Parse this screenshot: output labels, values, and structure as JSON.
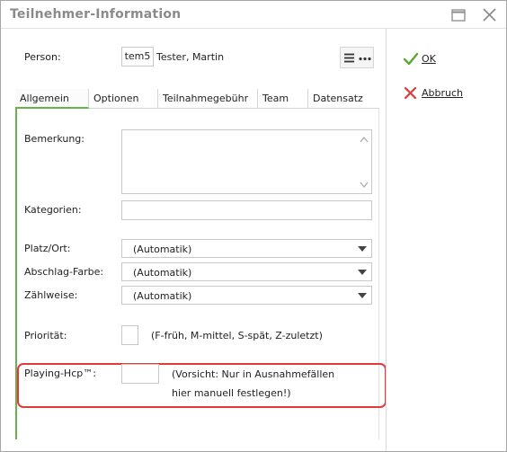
{
  "window": {
    "title": "Teilnehmer-Information"
  },
  "person": {
    "label": "Person:",
    "code": "tem5",
    "name": "Tester, Martin"
  },
  "tabs": [
    {
      "label": "Allgemein"
    },
    {
      "label": "Optionen"
    },
    {
      "label": "Teilnahmegebühr"
    },
    {
      "label": "Team"
    },
    {
      "label": "Datensatz"
    }
  ],
  "form": {
    "bemerkung_label": "Bemerkung:",
    "bemerkung_value": "",
    "kategorien_label": "Kategorien:",
    "kategorien_value": "",
    "platz_label": "Platz/Ort:",
    "platz_value": "(Automatik)",
    "abschlag_label": "Abschlag-Farbe:",
    "abschlag_value": "(Automatik)",
    "zaehlweise_label": "Zählweise:",
    "zaehlweise_value": "(Automatik)",
    "prioritaet_label": "Priorität:",
    "prioritaet_value": "",
    "prioritaet_hint": "(F-früh, M-mittel, S-spät, Z-zuletzt)",
    "hcp_label": "Playing-Hcp™:",
    "hcp_value": "",
    "hcp_hint_line1": "(Vorsicht: Nur in Ausnahmefällen",
    "hcp_hint_line2": "hier manuell festlegen!)"
  },
  "actions": {
    "ok_label": "OK",
    "cancel_label": "Abbruch"
  },
  "colors": {
    "accent_green": "#6ab04c",
    "ok_green": "#5aa832",
    "cancel_red": "#e03a3a",
    "highlight_red": "#e03a3a"
  },
  "icons": [
    "maximize-icon",
    "close-icon",
    "hamburger-icon",
    "more-dots-icon",
    "check-icon",
    "cross-icon",
    "scroll-up-icon",
    "scroll-down-icon",
    "dropdown-arrow-icon"
  ]
}
